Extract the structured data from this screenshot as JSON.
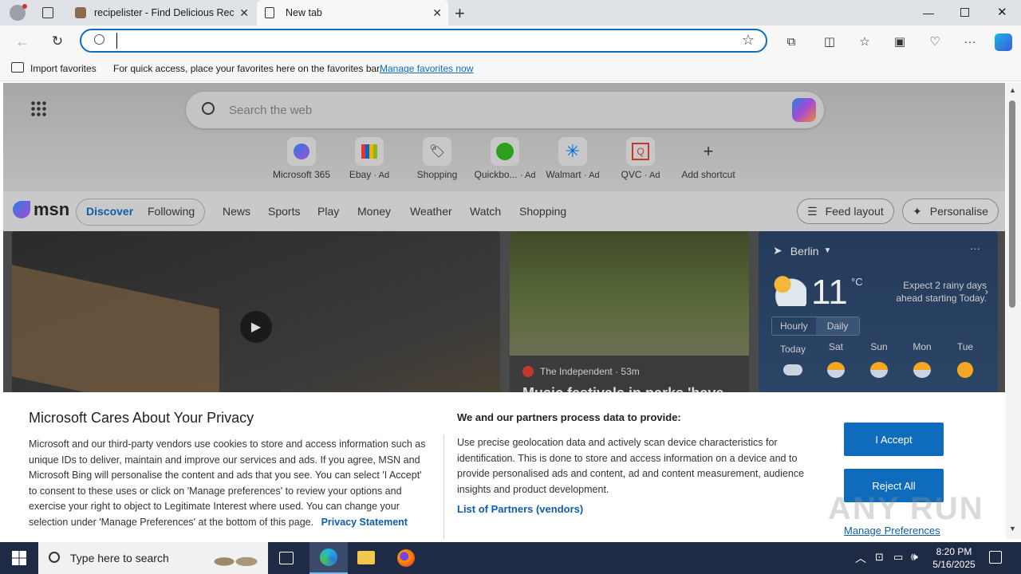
{
  "tabs": [
    {
      "label": "recipelister - Find Delicious Recip",
      "active": false
    },
    {
      "label": "New tab",
      "active": true
    }
  ],
  "address": {
    "value": "",
    "placeholder": ""
  },
  "favbar": {
    "import": "Import favorites",
    "message": "For quick access, place your favorites here on the favorites bar.",
    "link": "Manage favorites now"
  },
  "msn": {
    "search_placeholder": "Search the web",
    "shortcuts": [
      {
        "label": "Microsoft 365",
        "ad": ""
      },
      {
        "label": "Ebay",
        "ad": "· Ad"
      },
      {
        "label": "Shopping",
        "ad": ""
      },
      {
        "label": "Quickbo...",
        "ad": "· Ad"
      },
      {
        "label": "Walmart",
        "ad": "· Ad"
      },
      {
        "label": "QVC",
        "ad": "· Ad"
      },
      {
        "label": "Add shortcut",
        "ad": ""
      }
    ],
    "logo": "msn",
    "nav": {
      "discover": "Discover",
      "following": "Following",
      "items": [
        "News",
        "Sports",
        "Play",
        "Money",
        "Weather",
        "Watch",
        "Shopping"
      ]
    },
    "feed_layout": "Feed layout",
    "personalise": "Personalise",
    "news": {
      "source": "The Independent",
      "time": "· 53m",
      "headline": "Music festivals in parks 'have"
    },
    "weather": {
      "city": "Berlin",
      "temp": "11",
      "unit": "°C",
      "forecast": "Expect 2 rainy days ahead starting Today.",
      "tabs": [
        "Hourly",
        "Daily"
      ],
      "days": [
        "Today",
        "Sat",
        "Sun",
        "Mon",
        "Tue"
      ]
    }
  },
  "privacy": {
    "title": "Microsoft Cares About Your Privacy",
    "body": "Microsoft and our third-party vendors use cookies to store and access information such as unique IDs to deliver, maintain and improve our services and ads. If you agree, MSN and Microsoft Bing will personalise the content and ads that you see. You can select 'I Accept' to consent to these uses or click on 'Manage preferences' to review your options and exercise your right to object to Legitimate Interest where used.  You can change your selection under 'Manage Preferences' at the bottom of this page.",
    "privacy_link": "Privacy Statement",
    "right_title": "We and our partners process data to provide:",
    "right_body": "Use precise geolocation data and actively scan device characteristics for identification. This is done to store and access information on a device and to provide personalised ads and content, ad and content measurement, audience insights and product development.",
    "partners_link": "List of Partners (vendors)",
    "accept": "I Accept",
    "reject": "Reject All",
    "manage": "Manage Preferences"
  },
  "taskbar": {
    "search_placeholder": "Type here to search",
    "time": "8:20 PM",
    "date": "5/16/2025"
  },
  "watermark": "ANY RUN"
}
